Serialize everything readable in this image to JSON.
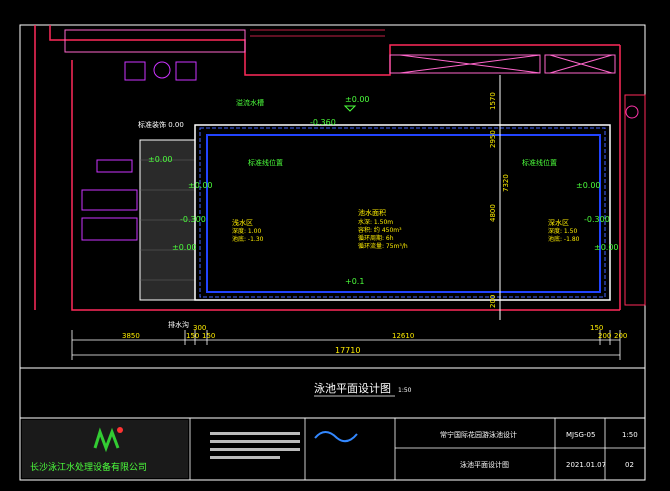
{
  "drawing": {
    "title": "泳池平面设计图",
    "scale": "1:50"
  },
  "levels": {
    "top_center": "±0.00",
    "top_left": "±0.00",
    "deck_left": "±0.00",
    "left_1": "±0.00",
    "left_2": "-0.300",
    "left_3": "±0.00",
    "right_1": "±0.00",
    "right_2": "-0.300",
    "right_3": "±0.00",
    "pool_edge": "-0.360",
    "bottom": "+0.1"
  },
  "notes": {
    "top_label": "溢流水槽",
    "left_label": "标准线位置",
    "right_label": "标准线位置",
    "pool_center": [
      "池水面积",
      "水深: 1.50m",
      "容积: 约 450m³",
      "循环周期: 6h",
      "循环流量: 75m³/h"
    ],
    "left_panel": [
      "浅水区",
      "深度: 1.00",
      "池底: -1.30"
    ],
    "right_panel": [
      "深水区",
      "深度: 1.50",
      "池底: -1.80"
    ],
    "deck_label": "标准装饰 0.00",
    "drain_label": "排水沟"
  },
  "dimensions": {
    "vertical": [
      "1570",
      "2950",
      "4800",
      "7320",
      "200"
    ],
    "horizontal_top": [
      "3850",
      "300",
      "150",
      "150",
      "12610",
      "150",
      "200",
      "200"
    ],
    "horizontal_total": "17710"
  },
  "title_block": {
    "company": "长沙泳江水处理设备有限公司",
    "project": "常宁国际花园游泳池设计",
    "sheet_name": "泳池平面设计图",
    "drawing_no": "MJSG-05",
    "scale": "1:50",
    "date": "2021.01.07",
    "page": "02"
  }
}
